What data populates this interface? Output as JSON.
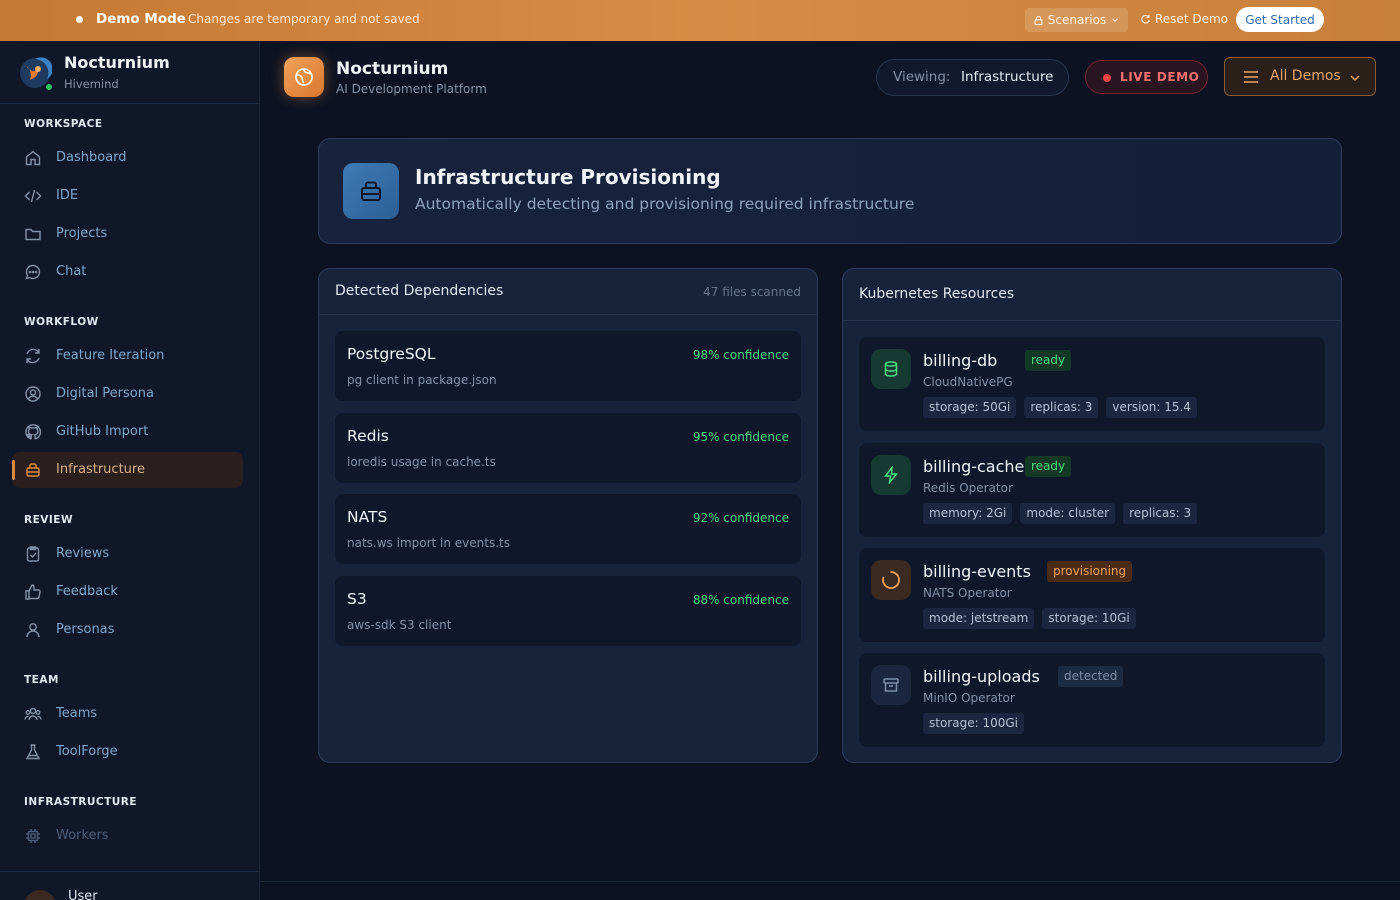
{
  "banner": {
    "mode_label": "Demo Mode",
    "note": "Changes are temporary and not saved",
    "scenarios_label": "Scenarios",
    "reset_label": "Reset Demo",
    "get_started_label": "Get Started"
  },
  "sidebar": {
    "brand_name": "Nocturnium",
    "brand_sub": "Hivemind",
    "sections": {
      "workspace": "WORKSPACE",
      "workflow": "WORKFLOW",
      "review": "REVIEW",
      "team": "TEAM",
      "infrastructure": "INFRASTRUCTURE"
    },
    "items": {
      "dashboard": "Dashboard",
      "ide": "IDE",
      "projects": "Projects",
      "chat": "Chat",
      "feature_iteration": "Feature Iteration",
      "digital_persona": "Digital Persona",
      "github_import": "GitHub Import",
      "infrastructure": "Infrastructure",
      "reviews": "Reviews",
      "feedback": "Feedback",
      "personas": "Personas",
      "teams": "Teams",
      "toolforge": "ToolForge",
      "workers": "Workers"
    },
    "user_name": "User"
  },
  "header": {
    "title": "Nocturnium",
    "subtitle": "AI Development Platform",
    "viewing_label": "Viewing:",
    "viewing_value": "Infrastructure",
    "live_label": "LIVE DEMO",
    "all_demos_label": "All Demos"
  },
  "hero": {
    "title": "Infrastructure Provisioning",
    "subtitle": "Automatically detecting and provisioning required infrastructure"
  },
  "dependencies": {
    "title": "Detected Dependencies",
    "files_scanned": "47 files scanned",
    "items": [
      {
        "name": "PostgreSQL",
        "confidence": "98% confidence",
        "detail": "pg client in package.json"
      },
      {
        "name": "Redis",
        "confidence": "95% confidence",
        "detail": "ioredis usage in cache.ts"
      },
      {
        "name": "NATS",
        "confidence": "92% confidence",
        "detail": "nats.ws import in events.ts"
      },
      {
        "name": "S3",
        "confidence": "88% confidence",
        "detail": "aws-sdk S3 client"
      }
    ]
  },
  "kubernetes": {
    "title": "Kubernetes Resources",
    "resources": [
      {
        "name": "billing-db",
        "status": "ready",
        "operator": "CloudNativePG",
        "tags": [
          "storage: 50Gi",
          "replicas: 3",
          "version: 15.4"
        ],
        "icon": "database-icon"
      },
      {
        "name": "billing-cache",
        "status": "ready",
        "operator": "Redis Operator",
        "tags": [
          "memory: 2Gi",
          "mode: cluster",
          "replicas: 3"
        ],
        "icon": "lightning-icon"
      },
      {
        "name": "billing-events",
        "status": "provisioning",
        "operator": "NATS Operator",
        "tags": [
          "mode: jetstream",
          "storage: 10Gi"
        ],
        "icon": "spinner-icon"
      },
      {
        "name": "billing-uploads",
        "status": "detected",
        "operator": "MinIO Operator",
        "tags": [
          "storage: 100Gi"
        ],
        "icon": "archive-icon"
      }
    ]
  },
  "colors": {
    "banner": "#d88c45",
    "accent": "#d98a3f",
    "ready": "#4ade80",
    "provisioning": "#f0a25a",
    "live": "#f87171"
  }
}
